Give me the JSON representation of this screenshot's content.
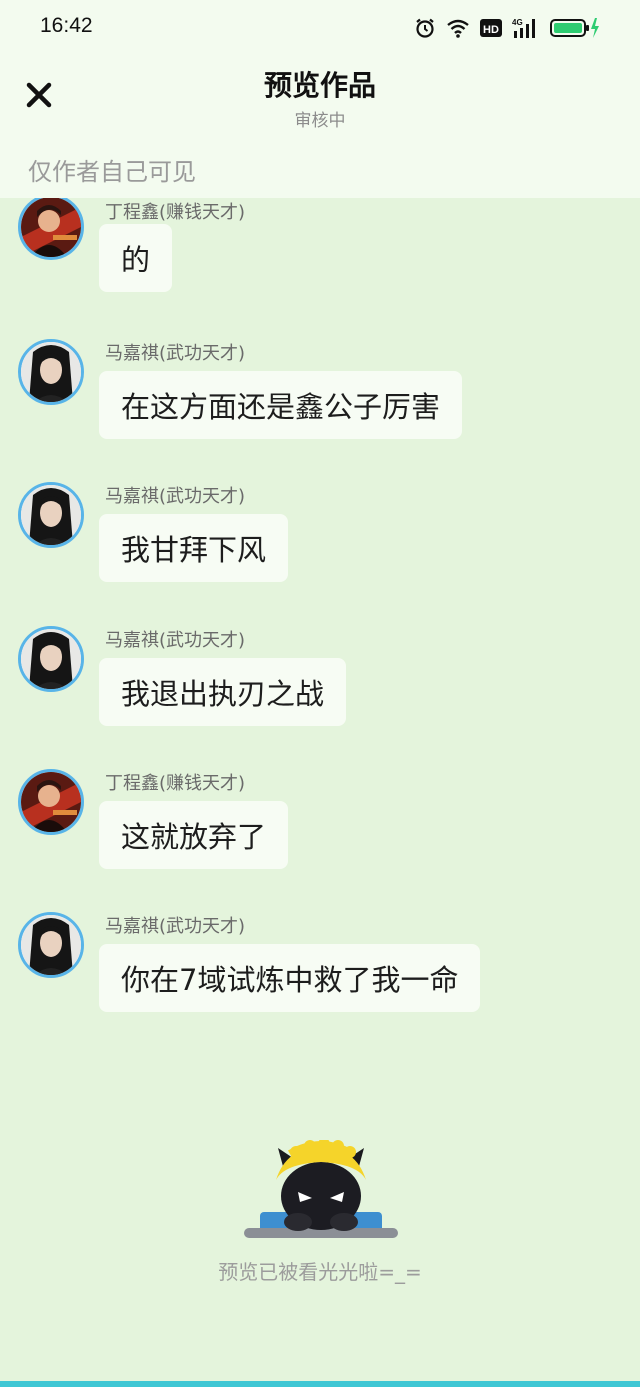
{
  "status_bar": {
    "time": "16:42",
    "icons": [
      "alarm-icon",
      "wifi-icon",
      "hd-icon",
      "signal-4g-icon",
      "battery-charging-icon"
    ],
    "network_label": "4G",
    "hd_label": "HD"
  },
  "header": {
    "title": "预览作品",
    "subtitle": "审核中",
    "close_icon": "close-icon"
  },
  "visibility_note": "仅作者自己可见",
  "messages": [
    {
      "sender": "丁程鑫(赚钱天才)",
      "text": "的",
      "avatar": "avatar-ding"
    },
    {
      "sender": "马嘉祺(武功天才)",
      "text": "在这方面还是鑫公子厉害",
      "avatar": "avatar-ma"
    },
    {
      "sender": "马嘉祺(武功天才)",
      "text": "我甘拜下风",
      "avatar": "avatar-ma"
    },
    {
      "sender": "马嘉祺(武功天才)",
      "text": "我退出执刃之战",
      "avatar": "avatar-ma"
    },
    {
      "sender": "丁程鑫(赚钱天才)",
      "text": "这就放弃了",
      "avatar": "avatar-ding"
    },
    {
      "sender": "马嘉祺(武功天才)",
      "text": "你在7域试炼中救了我一命",
      "avatar": "avatar-ma"
    }
  ],
  "footer": {
    "mascot": "mascot-icon",
    "end_text": "预览已被看光光啦=_="
  },
  "colors": {
    "background": "#e4f4dc",
    "header_background": "#f3fbef",
    "bubble": "#f7fcf4",
    "avatar_border": "#58b4e8",
    "accent_bar": "#3fc7d4"
  }
}
